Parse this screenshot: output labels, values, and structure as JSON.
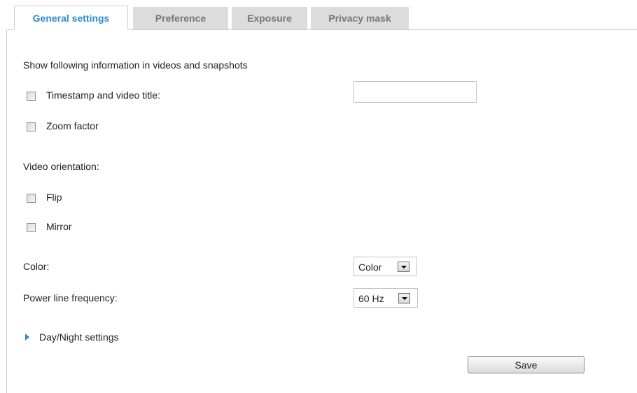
{
  "tabs": [
    {
      "label": "General settings"
    },
    {
      "label": "Preference"
    },
    {
      "label": "Exposure"
    },
    {
      "label": "Privacy mask"
    }
  ],
  "overlay": {
    "heading": "Show following information in videos and snapshots",
    "timestamp_label": "Timestamp and video title:",
    "timestamp_value": "",
    "zoom_label": "Zoom factor"
  },
  "orientation": {
    "heading": "Video orientation:",
    "flip_label": "Flip",
    "mirror_label": "Mirror"
  },
  "color": {
    "label": "Color:",
    "selected": "Color"
  },
  "power": {
    "label": "Power line frequency:",
    "selected": "60 Hz"
  },
  "daynight": {
    "label": "Day/Night settings"
  },
  "actions": {
    "save_label": "Save"
  },
  "colors": {
    "accent": "#2d8bd0",
    "inactive_tab": "#dcdcdc"
  }
}
